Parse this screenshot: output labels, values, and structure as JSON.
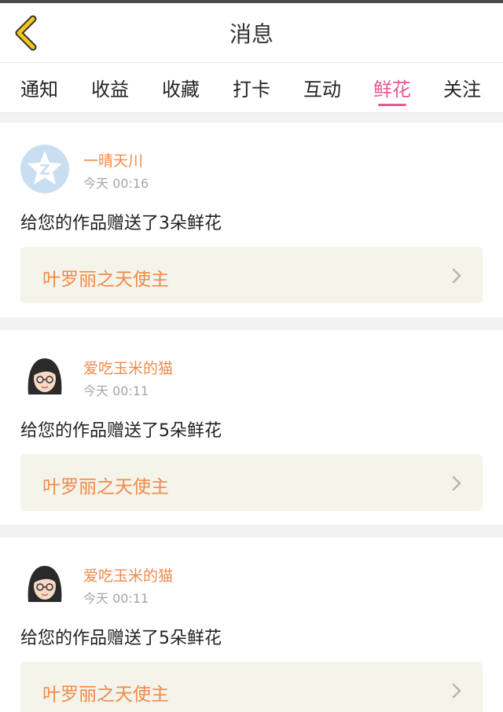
{
  "header": {
    "title": "消息",
    "back_icon": "chevron-left-icon",
    "back_icon_color": "#f5c518"
  },
  "tabs": [
    {
      "label": "通知",
      "active": false
    },
    {
      "label": "收益",
      "active": false
    },
    {
      "label": "收藏",
      "active": false
    },
    {
      "label": "打卡",
      "active": false
    },
    {
      "label": "互动",
      "active": false
    },
    {
      "label": "鲜花",
      "active": true
    },
    {
      "label": "关注",
      "active": false
    }
  ],
  "colors": {
    "accent": "#e8598f",
    "name": "#f08a4b",
    "muted": "#a6a6a6"
  },
  "notifications": [
    {
      "user": "一晴天川",
      "time": "今天 00:16",
      "message": "给您的作品赠送了3朵鲜花",
      "work_title": "叶罗丽之天使主",
      "avatar": "qq-default-avatar"
    },
    {
      "user": "爱吃玉米的猫",
      "time": "今天 00:11",
      "message": "给您的作品赠送了5朵鲜花",
      "work_title": "叶罗丽之天使主",
      "avatar": "girl-glasses-avatar"
    },
    {
      "user": "爱吃玉米的猫",
      "time": "今天 00:11",
      "message": "给您的作品赠送了5朵鲜花",
      "work_title": "叶罗丽之天使主",
      "avatar": "girl-glasses-avatar"
    }
  ]
}
